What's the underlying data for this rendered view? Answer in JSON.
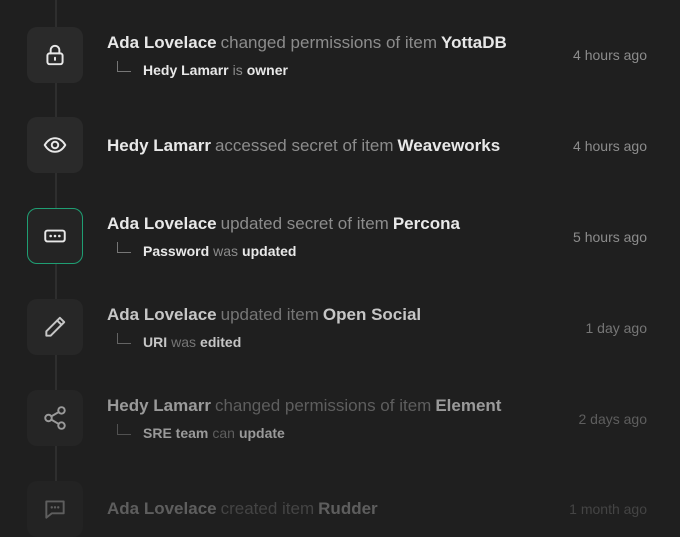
{
  "activity": [
    {
      "icon": "lock-icon",
      "actor": "Ada Lovelace",
      "action": "changed permissions of item",
      "target": "YottaDB",
      "detail": {
        "subject": "Hedy Lamarr",
        "link": "is",
        "value": "owner"
      },
      "time": "4 hours ago"
    },
    {
      "icon": "eye-icon",
      "actor": "Hedy Lamarr",
      "action": "accessed secret of item",
      "target": "Weaveworks",
      "time": "4 hours ago"
    },
    {
      "icon": "password-icon",
      "actor": "Ada Lovelace",
      "action": "updated secret of item",
      "target": "Percona",
      "detail": {
        "subject": "Password",
        "link": "was",
        "value": "updated"
      },
      "time": "5 hours ago"
    },
    {
      "icon": "pencil-icon",
      "actor": "Ada Lovelace",
      "action": "updated item",
      "target": "Open Social",
      "detail": {
        "subject": "URI",
        "link": "was",
        "value": "edited"
      },
      "time": "1 day ago"
    },
    {
      "icon": "share-icon",
      "actor": "Hedy Lamarr",
      "action": "changed permissions of item",
      "target": "Element",
      "detail": {
        "subject": "SRE team",
        "link": "can",
        "value": "update"
      },
      "time": "2 days ago"
    },
    {
      "icon": "message-icon",
      "actor": "Ada Lovelace",
      "action": "created item",
      "target": "Rudder",
      "time": "1 month ago"
    }
  ],
  "colors": {
    "background": "#1f1f1f",
    "icon_tile": "#2a2a2a",
    "active_border": "#1f9e73"
  }
}
